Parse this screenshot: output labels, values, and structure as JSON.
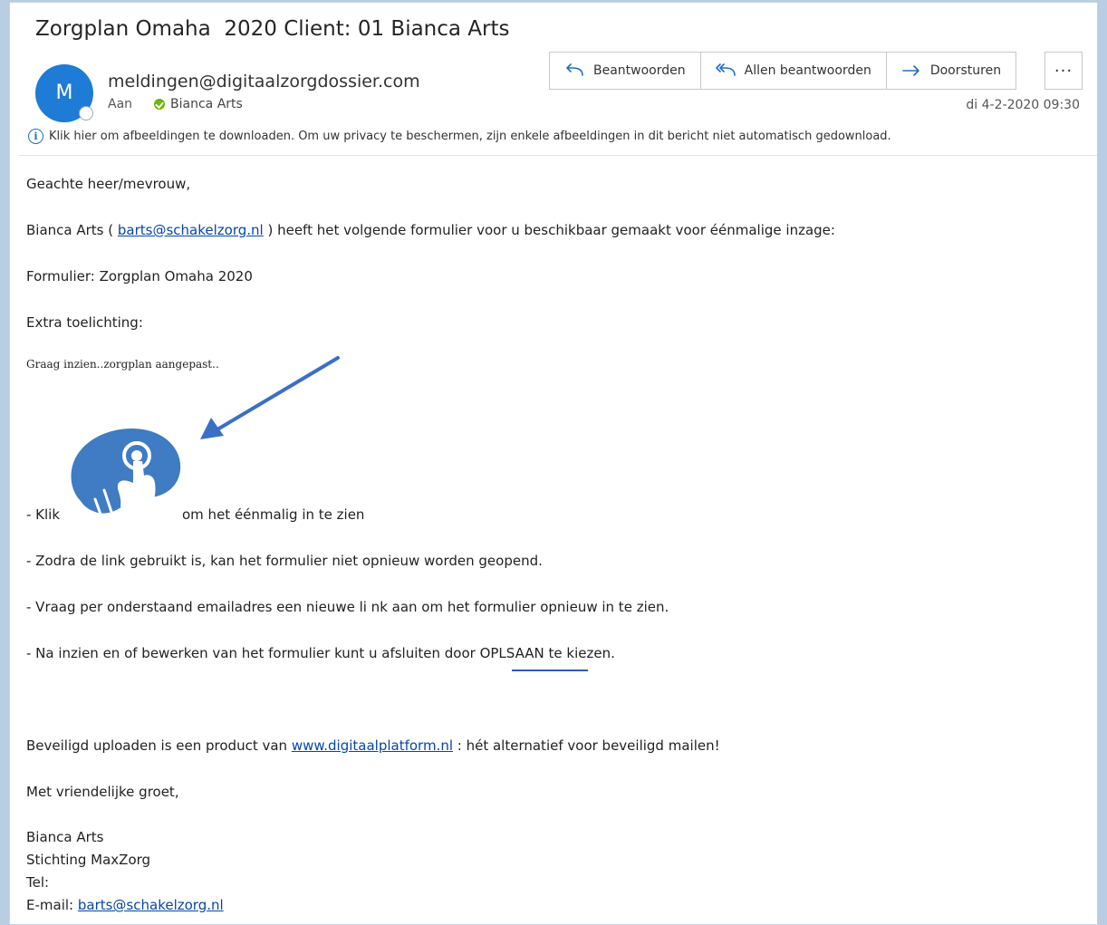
{
  "email": {
    "subject": "Zorgplan Omaha  2020 Client: 01 Bianca Arts",
    "avatar_initial": "M",
    "sender": "meldingen@digitaalzorgdossier.com",
    "to_label": "Aan",
    "to_name": "Bianca Arts",
    "date": "di 4-2-2020 09:30",
    "info_text": "Klik hier om afbeeldingen te downloaden. Om uw privacy te beschermen, zijn enkele afbeeldingen in dit bericht niet automatisch gedownload."
  },
  "toolbar": {
    "reply_label": "Beantwoorden",
    "reply_all_label": "Allen beantwoorden",
    "forward_label": "Doorsturen",
    "more_label": "···"
  },
  "body": {
    "greeting": "Geachte heer/mevrouw,",
    "intro_before": "Bianca Arts ( ",
    "intro_link": "barts@schakelzorg.nl",
    "intro_after": " ) heeft het volgende formulier voor u beschikbaar gemaakt voor éénmalige inzage:",
    "form_line": "Formulier: Zorgplan Omaha 2020",
    "extra_label": "Extra toelichting:",
    "extra_note": "Graag inzien..zorgplan aangepast..",
    "klik_before": "- Klik",
    "klik_after": "om het éénmalig in te zien",
    "bullet_2": "- Zodra de link gebruikt is, kan het formulier niet opnieuw worden geopend.",
    "bullet_3": "- Vraag per onderstaand emailadres een nieuwe li nk aan om het formulier opnieuw in te zien.",
    "bullet_4": "- Na inzien en of bewerken van het formulier kunt u afsluiten door OPLSAAN te kiezen.",
    "footer_before": "Beveiligd uploaden is een product van ",
    "footer_link": "www.digitaalplatform.nl",
    "footer_after": " : hét alternatief voor beveiligd mailen!",
    "closing": "Met vriendelijke groet,",
    "sig_name": "Bianca Arts",
    "sig_org": "Stichting MaxZorg",
    "sig_tel": "Tel:",
    "sig_email_label": "E-mail: ",
    "sig_email": "barts@schakelzorg.nl"
  },
  "colors": {
    "accent": "#1e6fc8",
    "avatar": "#1e7bd6",
    "logo": "#3f7cc3",
    "annotation_arrow": "#3a6fc5"
  }
}
